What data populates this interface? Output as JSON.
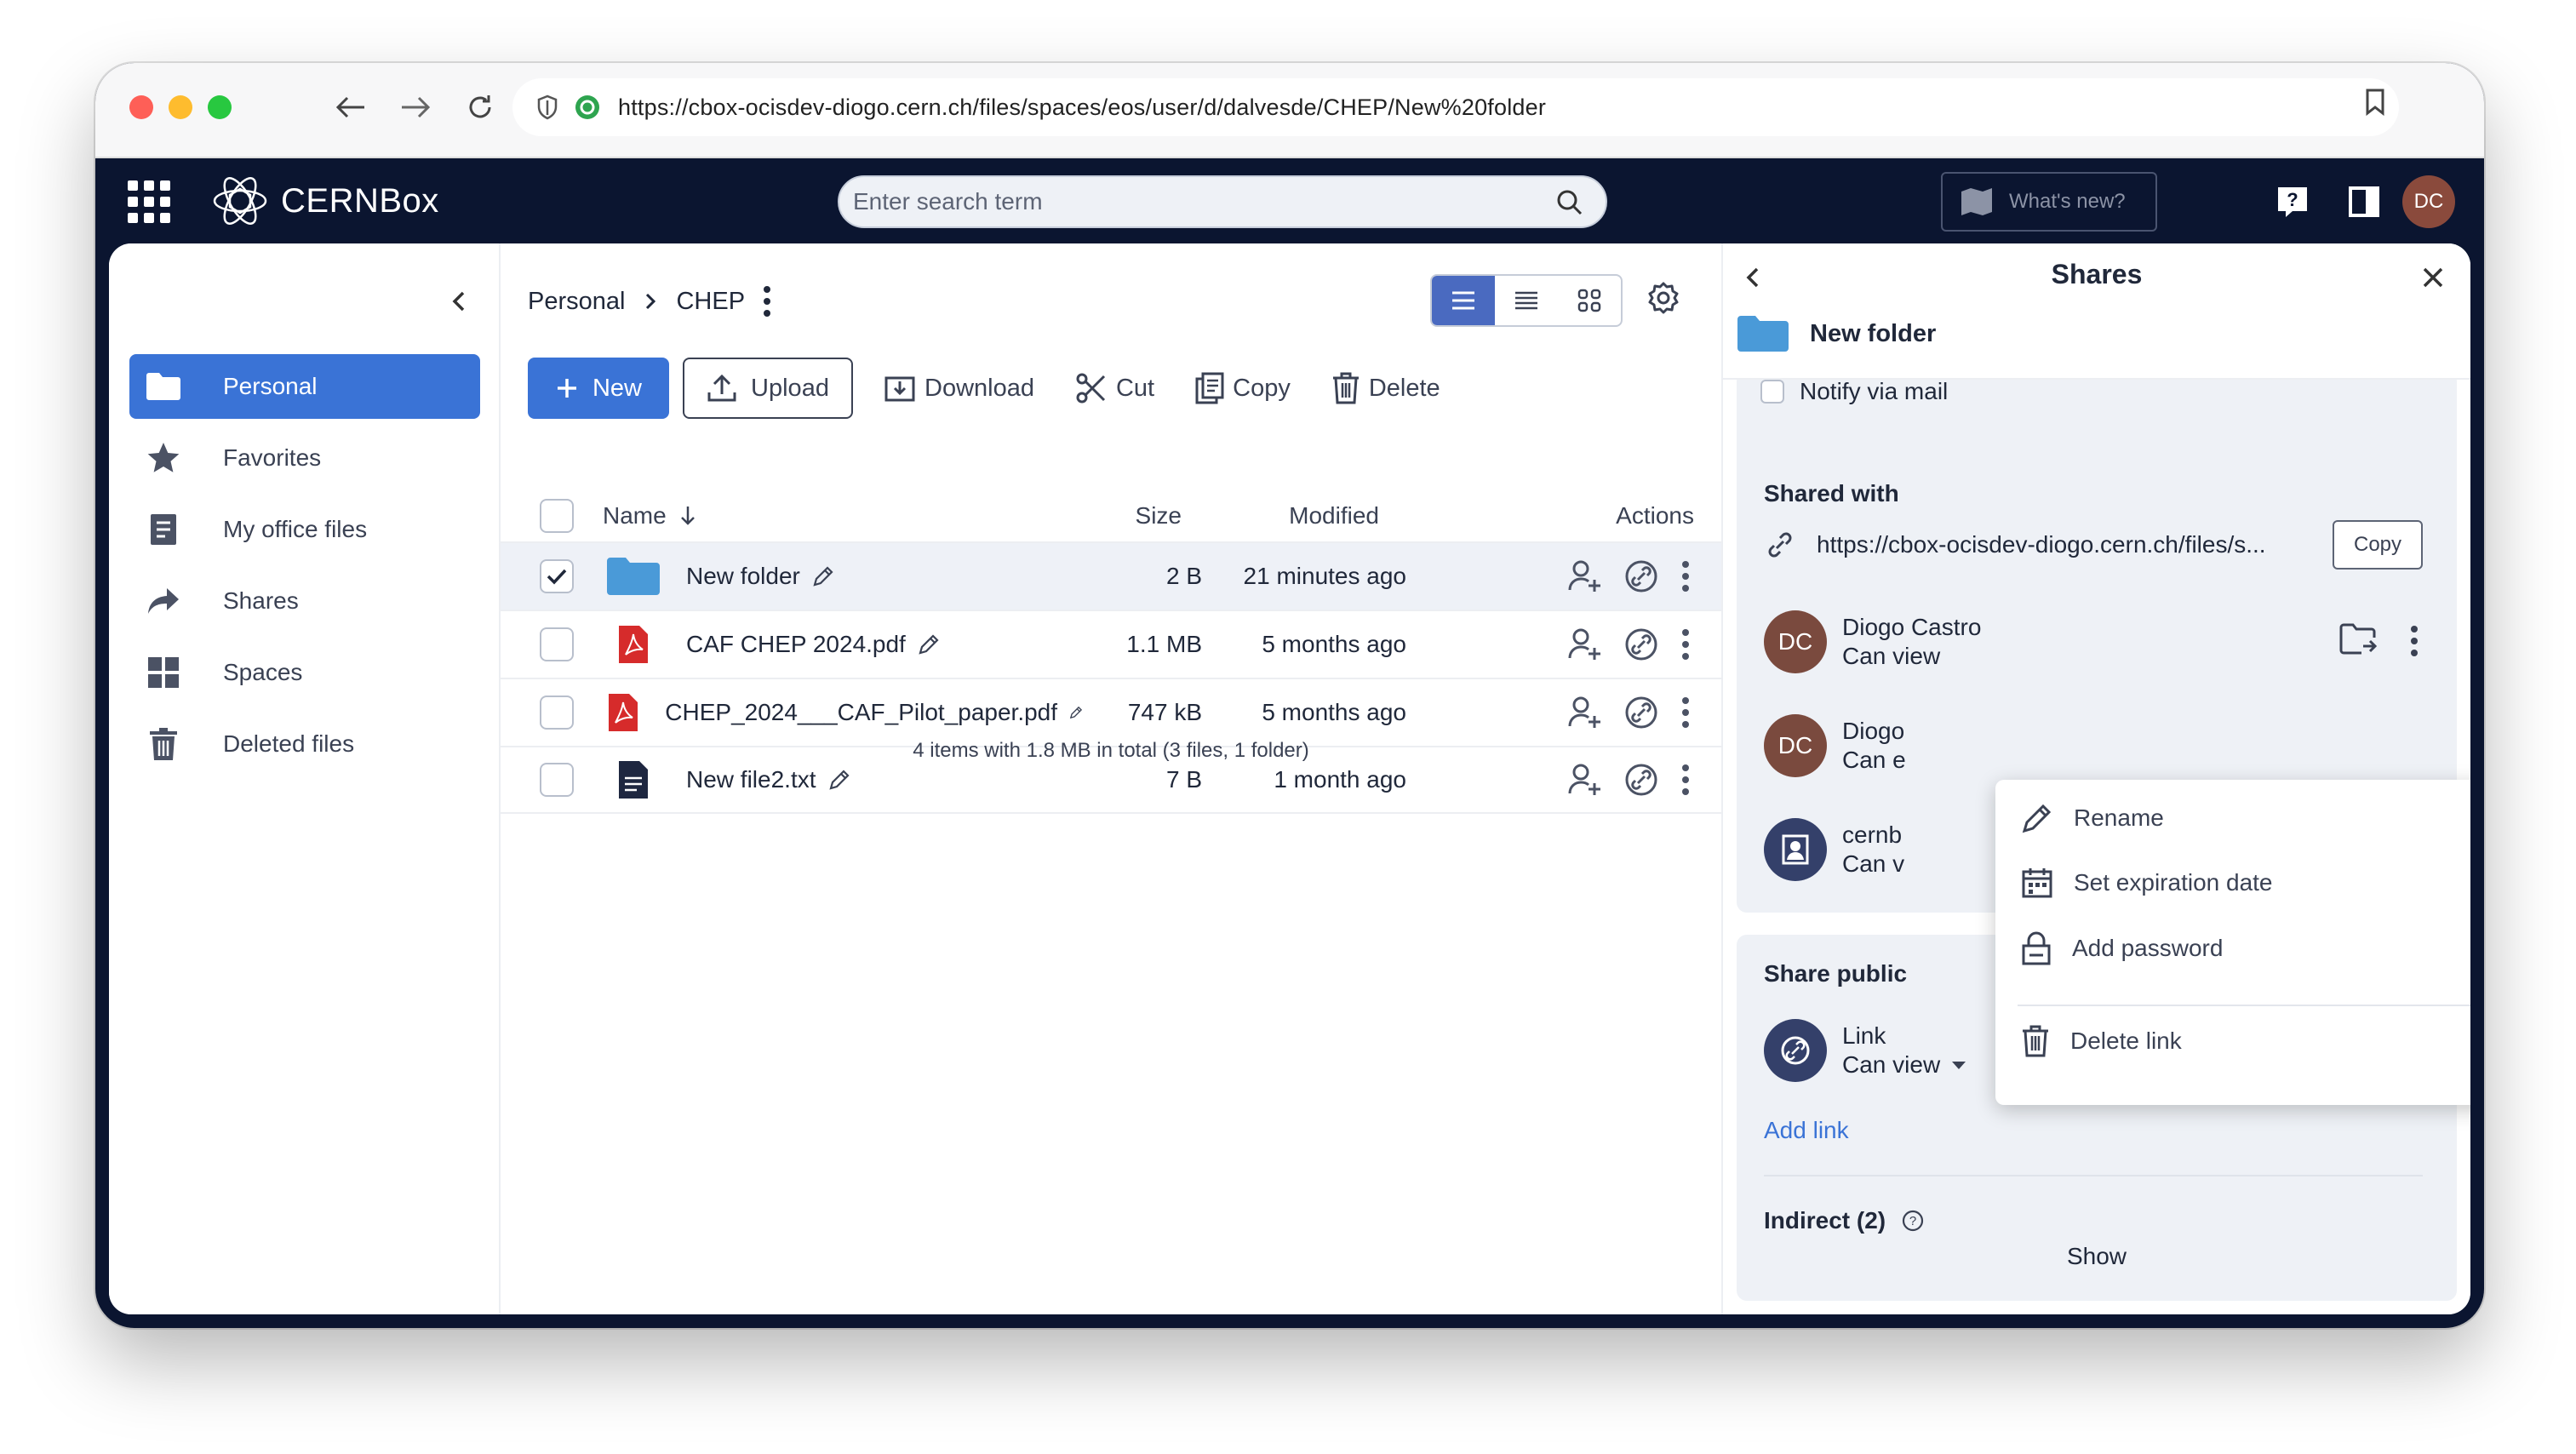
{
  "browser": {
    "url": "https://cbox-ocisdev-diogo.cern.ch/files/spaces/eos/user/d/dalvesde/CHEP/New%20folder"
  },
  "topbar": {
    "logo_text": "CERNBox",
    "search_placeholder": "Enter search term",
    "whats_new_label": "What's new?",
    "avatar_initials": "DC"
  },
  "sidebar": {
    "items": [
      {
        "label": "Personal",
        "icon": "folder-icon",
        "active": true
      },
      {
        "label": "Favorites",
        "icon": "star-icon",
        "active": false
      },
      {
        "label": "My office files",
        "icon": "document-icon",
        "active": false
      },
      {
        "label": "Shares",
        "icon": "share-arrow-icon",
        "active": false
      },
      {
        "label": "Spaces",
        "icon": "spaces-grid-icon",
        "active": false
      },
      {
        "label": "Deleted files",
        "icon": "trash-icon",
        "active": false
      }
    ]
  },
  "breadcrumb": {
    "root": "Personal",
    "current": "CHEP"
  },
  "toolbar": {
    "new_label": "New",
    "upload_label": "Upload",
    "download_label": "Download",
    "cut_label": "Cut",
    "copy_label": "Copy",
    "delete_label": "Delete"
  },
  "table": {
    "headers": {
      "name": "Name",
      "size": "Size",
      "modified": "Modified",
      "actions": "Actions"
    },
    "rows": [
      {
        "name": "New folder",
        "type": "folder",
        "size": "2 B",
        "modified": "21 minutes ago",
        "selected": true
      },
      {
        "name": "CAF CHEP 2024.pdf",
        "type": "pdf",
        "size": "1.1 MB",
        "modified": "5 months ago",
        "selected": false
      },
      {
        "name": "CHEP_2024___CAF_Pilot_paper.pdf",
        "type": "pdf",
        "size": "747 kB",
        "modified": "5 months ago",
        "selected": false
      },
      {
        "name": "New file2.txt",
        "type": "txt",
        "size": "7 B",
        "modified": "1 month ago",
        "selected": false
      }
    ],
    "summary": "4 items with 1.8 MB in total (3 files, 1 folder)"
  },
  "panel": {
    "title": "Shares",
    "item_name": "New folder",
    "notify_label": "Notify via mail",
    "shared_with_label": "Shared with",
    "shared_link_url": "https://cbox-ocisdev-diogo.cern.ch/files/s...",
    "copy_label": "Copy",
    "shares": [
      {
        "initials": "DC",
        "name": "Diogo Castro",
        "role": "Can view"
      },
      {
        "initials": "DC",
        "name": "Diogo",
        "role": "Can e"
      },
      {
        "initials": "",
        "name": "cernb",
        "role": "Can v"
      }
    ],
    "public_section_label": "Share public",
    "public_link": {
      "name": "Link",
      "role": "Can view"
    },
    "add_link_label": "Add link",
    "indirect_label": "Indirect (2)",
    "show_label": "Show"
  },
  "dropdown": {
    "items": [
      {
        "label": "Rename",
        "icon": "pencil-icon"
      },
      {
        "label": "Set expiration date",
        "icon": "calendar-icon"
      },
      {
        "label": "Add password",
        "icon": "lock-icon"
      },
      {
        "label": "Delete link",
        "icon": "trash-icon"
      }
    ]
  },
  "colors": {
    "topbar_bg": "#0b1530",
    "accent": "#3a73d6",
    "folder": "#4a9ad8",
    "pdf": "#d62b2b",
    "avatar_brown": "#7a4a3e"
  }
}
